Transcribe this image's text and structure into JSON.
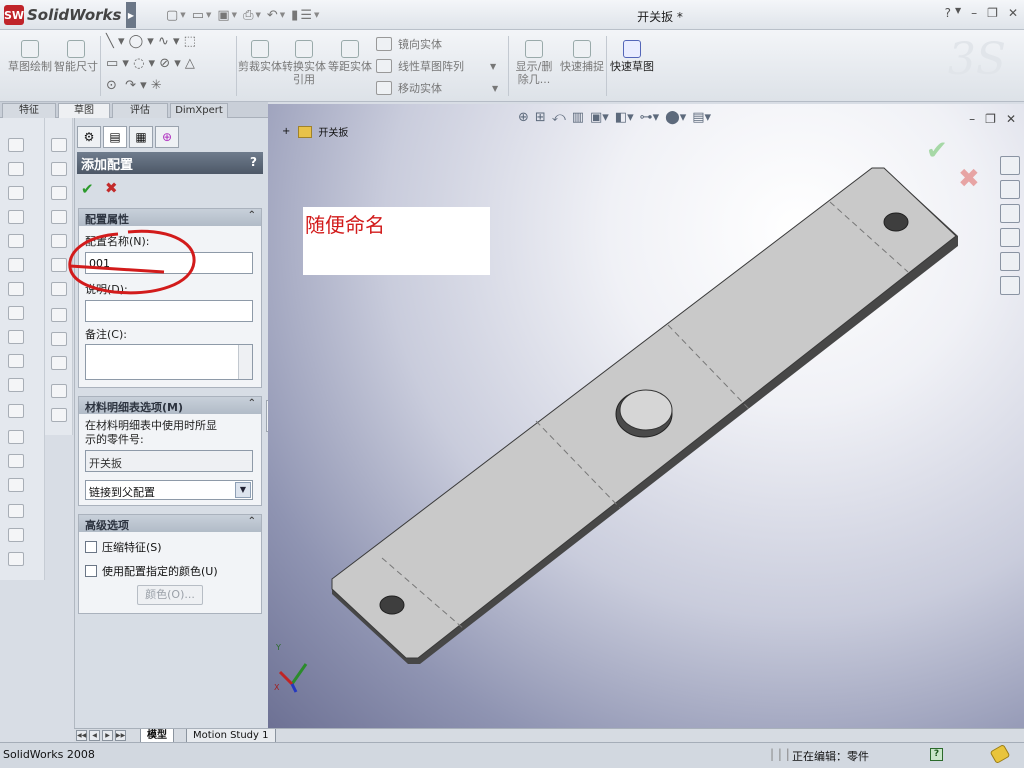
{
  "app": {
    "name": "SolidWorks",
    "logo_text": "SW",
    "document_title": "开关扳 *"
  },
  "ribbon": {
    "buttons": [
      {
        "label": "草图绘制",
        "icon": "sketch-icon"
      },
      {
        "label": "智能尺寸",
        "icon": "smart-dimension-icon"
      },
      {
        "label": "剪裁实体",
        "icon": "trim-entities-icon"
      },
      {
        "label": "转换实体引用",
        "icon": "convert-entities-icon"
      },
      {
        "label": "等距实体",
        "icon": "offset-entities-icon"
      },
      {
        "label": "显示/删除几...",
        "icon": "display-delete-relations-icon"
      },
      {
        "label": "快速捕捉",
        "icon": "quick-snaps-icon"
      },
      {
        "label": "快速草图",
        "icon": "rapid-sketch-icon"
      }
    ],
    "small_items": [
      {
        "label": "镜向实体",
        "icon": "mirror-entities-icon"
      },
      {
        "label": "线性草图阵列",
        "icon": "linear-pattern-icon"
      },
      {
        "label": "移动实体",
        "icon": "move-entities-icon"
      }
    ]
  },
  "command_tabs": [
    {
      "label": "特征"
    },
    {
      "label": "草图",
      "active": true
    },
    {
      "label": "评估"
    },
    {
      "label": "DimXpert"
    }
  ],
  "property_manager": {
    "title": "添加配置",
    "help": "?",
    "ok_symbol": "✔",
    "cancel_symbol": "✖",
    "config_properties": {
      "header": "配置属性",
      "name_label": "配置名称(N):",
      "name_value": "001",
      "description_label": "说明(D):",
      "description_value": "",
      "comment_label": "备注(C):",
      "comment_value": ""
    },
    "bom_options": {
      "header": "材料明细表选项(M)",
      "help_line1": "在材料明细表中使用时所显",
      "help_line2": "示的零件号:",
      "part_number": "开关扳",
      "link_option": "链接到父配置"
    },
    "advanced": {
      "header": "高级选项",
      "suppress_features": "压缩特征(S)",
      "suppress_checked": false,
      "use_config_color": "使用配置指定的颜色(U)",
      "use_color_checked": false,
      "color_button": "颜色(O)..."
    }
  },
  "viewport": {
    "feature_tree_root": "开关扳",
    "note_text": "随便命名",
    "triad_x": "X",
    "triad_y": "Y"
  },
  "model_tabs": [
    {
      "label": "模型",
      "active": true
    },
    {
      "label": "Motion Study 1"
    }
  ],
  "status_bar": {
    "left": "SolidWorks 2008",
    "editing": "正在编辑：零件",
    "help": "?"
  },
  "colors": {
    "annotation_red": "#d21b1b",
    "part_fill": "#c9c9c9",
    "brand_red": "#c0242a"
  }
}
